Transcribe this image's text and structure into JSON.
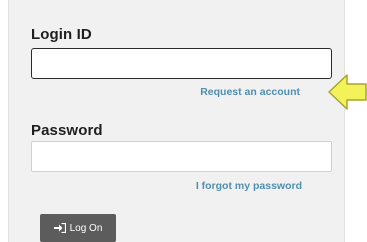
{
  "login": {
    "login_id_label": "Login ID",
    "login_id_value": "",
    "request_account_link": "Request an account",
    "password_label": "Password",
    "password_value": "",
    "forgot_password_link": "I forgot my password",
    "logon_button_label": "Log On"
  },
  "colors": {
    "link": "#4f8fb0",
    "button_bg": "#5c5c5c",
    "arrow_fill": "#f4f25a",
    "arrow_stroke": "#a9a52a"
  },
  "icons": {
    "logon_icon": "sign-in-icon",
    "pointer": "left-arrow-icon"
  }
}
